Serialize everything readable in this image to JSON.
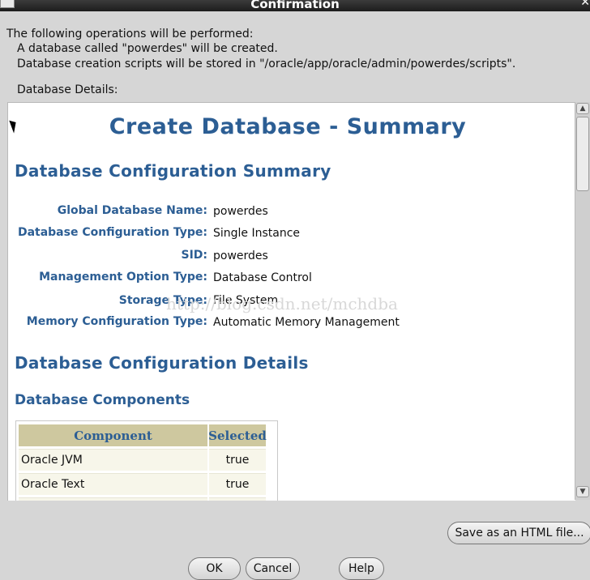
{
  "window": {
    "title": "Confirmation"
  },
  "intro": {
    "line1": "The following operations will be performed:",
    "line2": "A database called \"powerdes\" will be created.",
    "line3": "Database creation scripts will be stored in \"/oracle/app/oracle/admin/powerdes/scripts\".",
    "details_label": "Database Details:"
  },
  "summary": {
    "title": "Create Database - Summary",
    "config_summary_heading": "Database Configuration Summary",
    "fields": [
      {
        "label": "Global Database Name:",
        "value": "powerdes"
      },
      {
        "label": "Database Configuration Type:",
        "value": "Single Instance"
      },
      {
        "label": "SID:",
        "value": "powerdes"
      },
      {
        "label": "Management Option Type:",
        "value": "Database Control"
      },
      {
        "label": "Storage Type:",
        "value": "File System"
      },
      {
        "label": "Memory Configuration Type:",
        "value": "Automatic Memory Management"
      }
    ],
    "watermark": "http://blog.csdn.net/mchdba",
    "config_details_heading": "Database Configuration Details",
    "components_heading": "Database Components",
    "components_table": {
      "headers": [
        "Component",
        "Selected"
      ],
      "rows": [
        [
          "Oracle JVM",
          "true"
        ],
        [
          "Oracle Text",
          "true"
        ],
        [
          "",
          ""
        ]
      ]
    }
  },
  "buttons": {
    "save_html": "Save as an HTML file...",
    "ok": "OK",
    "cancel": "Cancel",
    "help": "Help"
  }
}
